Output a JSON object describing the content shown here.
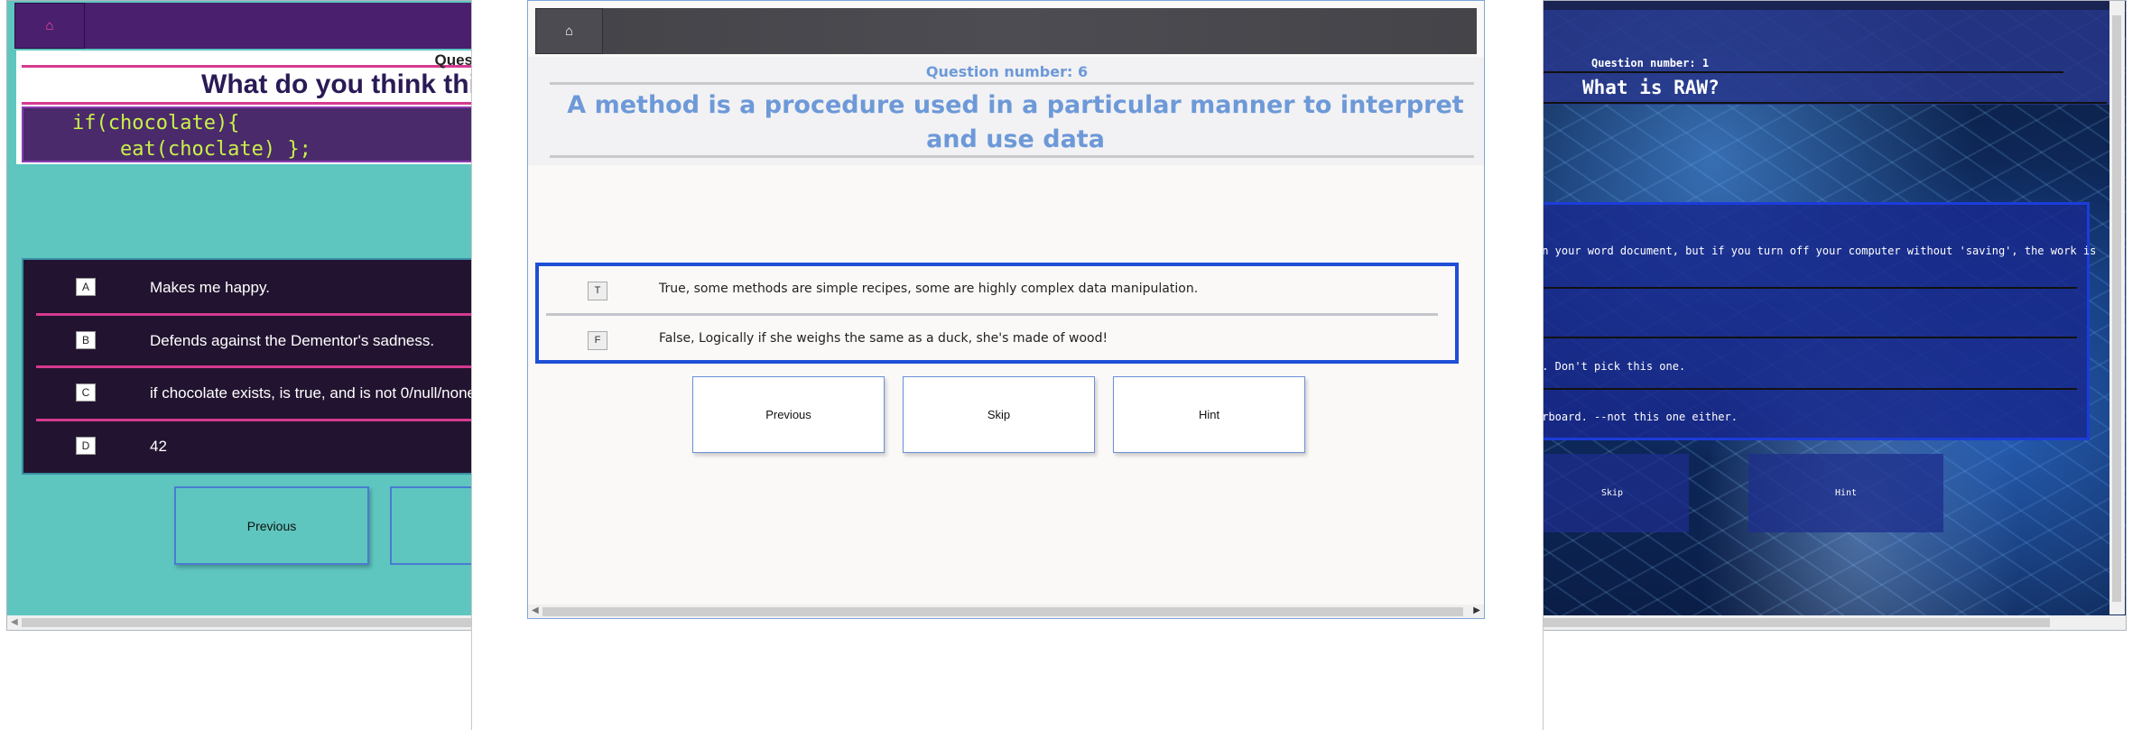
{
  "left": {
    "home_icon": "home-icon",
    "question_number": "Ques",
    "question_title": "What do you think thi",
    "code_lines": [
      "if(chocolate){",
      "    eat(choclate) };"
    ],
    "answers": [
      {
        "key": "A",
        "text": "Makes me happy."
      },
      {
        "key": "B",
        "text": "Defends against the Dementor's sadness."
      },
      {
        "key": "C",
        "text": "if chocolate exists, is true, and is not 0/null/none,"
      },
      {
        "key": "D",
        "text": "42"
      }
    ],
    "previous_label": "Previous",
    "colors": {
      "background": "#5ec6bf",
      "header": "#4a1f6e",
      "accent": "#d63a8f",
      "code": "#c9f249"
    }
  },
  "middle": {
    "home_icon": "home-icon",
    "question_number": "Question number: 6",
    "question_title": "A method is a procedure used in a particular manner to interpret and use data",
    "answers": [
      {
        "key": "T",
        "text": "True, some methods are simple recipes, some are highly complex data manipulation."
      },
      {
        "key": "F",
        "text": "False, Logically if she weighs the same as a duck, she's made of wood!"
      }
    ],
    "buttons": {
      "previous": "Previous",
      "skip": "Skip",
      "hint": "Hint"
    },
    "colors": {
      "title": "#6d99d8",
      "answers_border": "#1f4fd6",
      "header": "#434348"
    }
  },
  "right": {
    "question_number": "Question number: 1",
    "question_title": "What is RAW?",
    "answers": [
      "on your word document, but if you turn off your computer without 'saving', the work is",
      "",
      ".. Don't pick this one.",
      "erboard. --not this one either."
    ],
    "buttons": {
      "skip": "Skip",
      "hint": "Hint"
    },
    "colors": {
      "panel": "#1c3cd9"
    }
  }
}
